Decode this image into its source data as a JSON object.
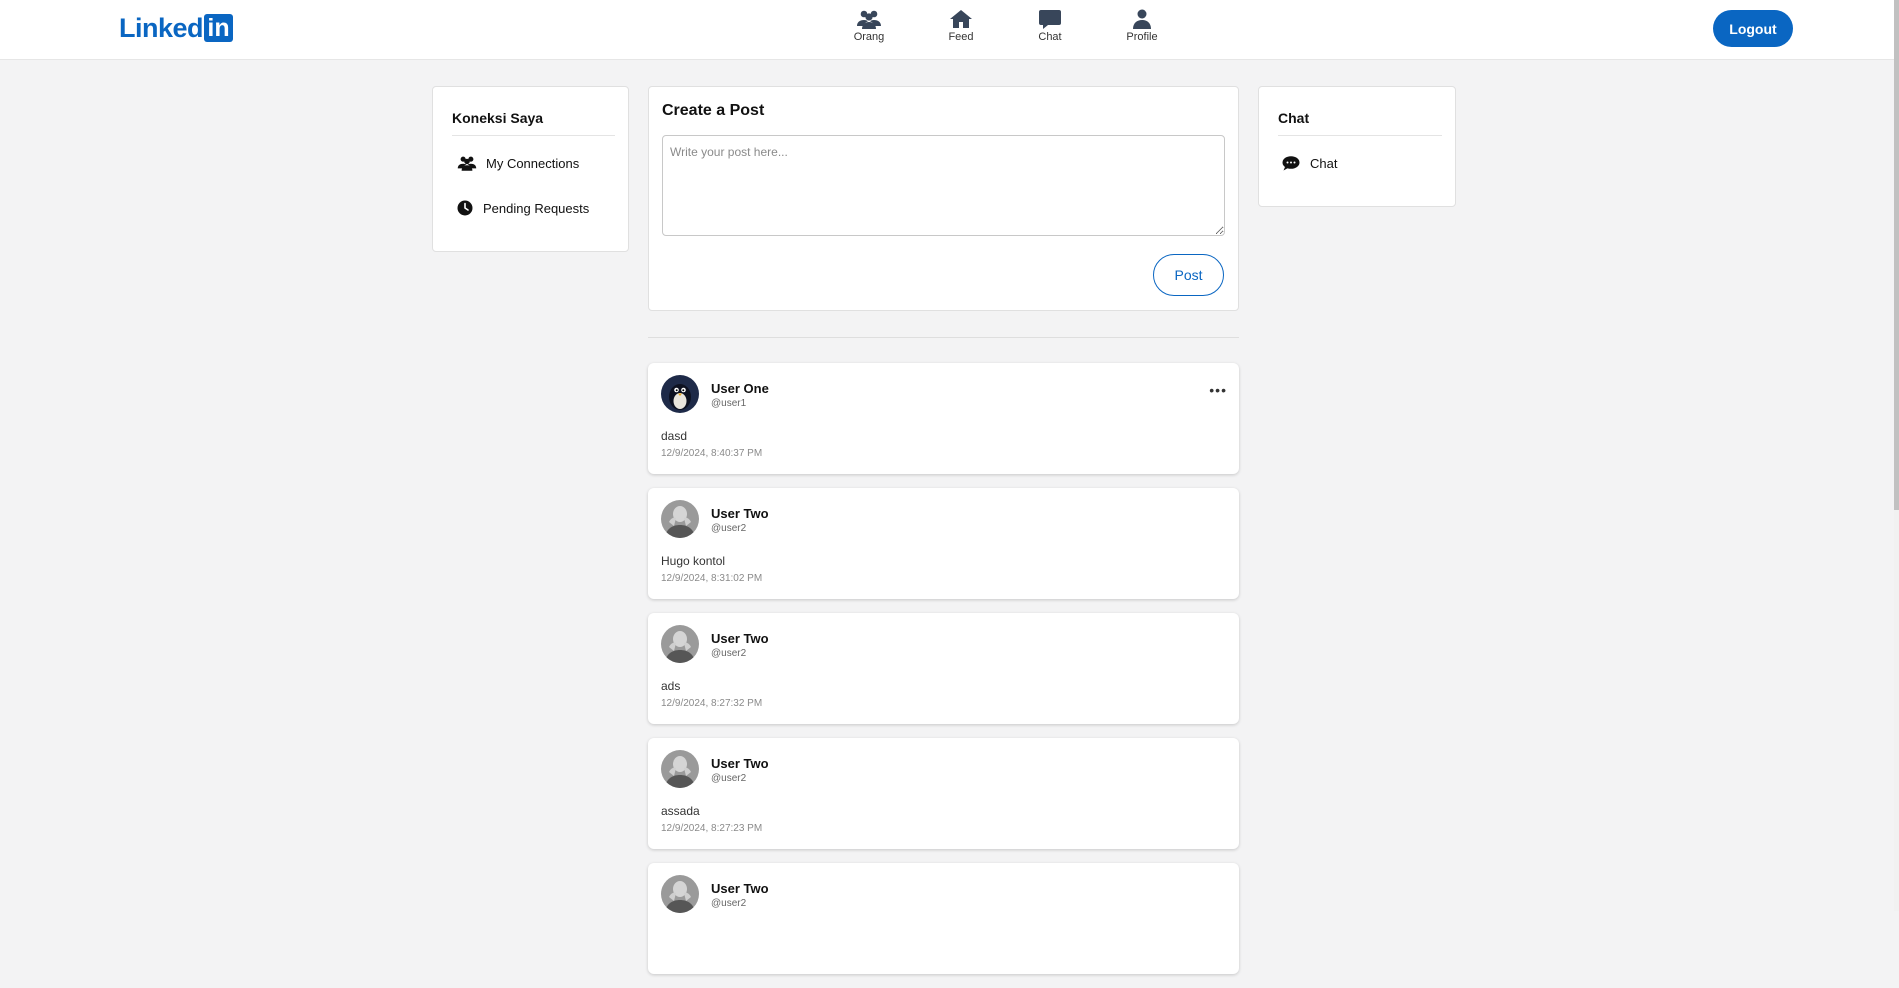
{
  "brand": {
    "logo_text": "Linked",
    "logo_box": "in",
    "color": "#0a66c2"
  },
  "nav": {
    "items": [
      {
        "label": "Orang",
        "icon": "users-icon"
      },
      {
        "label": "Feed",
        "icon": "home-icon"
      },
      {
        "label": "Chat",
        "icon": "chat-bubble-icon"
      },
      {
        "label": "Profile",
        "icon": "user-icon"
      }
    ],
    "logout_label": "Logout"
  },
  "left_sidebar": {
    "title": "Koneksi Saya",
    "items": [
      {
        "label": "My Connections",
        "icon": "users-icon"
      },
      {
        "label": "Pending Requests",
        "icon": "clock-icon"
      }
    ]
  },
  "create_post": {
    "title": "Create a Post",
    "placeholder": "Write your post here...",
    "value": "",
    "post_label": "Post"
  },
  "right_sidebar": {
    "title": "Chat",
    "items": [
      {
        "label": "Chat",
        "icon": "chat-bubbles-icon"
      }
    ]
  },
  "posts": [
    {
      "name": "User One",
      "handle": "@user1",
      "content": "dasd",
      "time": "12/9/2024, 8:40:37 PM",
      "avatar": "penguin-avatar",
      "has_menu": true
    },
    {
      "name": "User Two",
      "handle": "@user2",
      "content": "Hugo kontol",
      "time": "12/9/2024, 8:31:02 PM",
      "avatar": "photo-avatar",
      "has_menu": false
    },
    {
      "name": "User Two",
      "handle": "@user2",
      "content": "ads",
      "time": "12/9/2024, 8:27:32 PM",
      "avatar": "photo-avatar",
      "has_menu": false
    },
    {
      "name": "User Two",
      "handle": "@user2",
      "content": "assada",
      "time": "12/9/2024, 8:27:23 PM",
      "avatar": "photo-avatar",
      "has_menu": false
    },
    {
      "name": "User Two",
      "handle": "@user2",
      "content": "",
      "time": "",
      "avatar": "photo-avatar",
      "has_menu": false
    }
  ],
  "more_menu_glyph": "•••"
}
